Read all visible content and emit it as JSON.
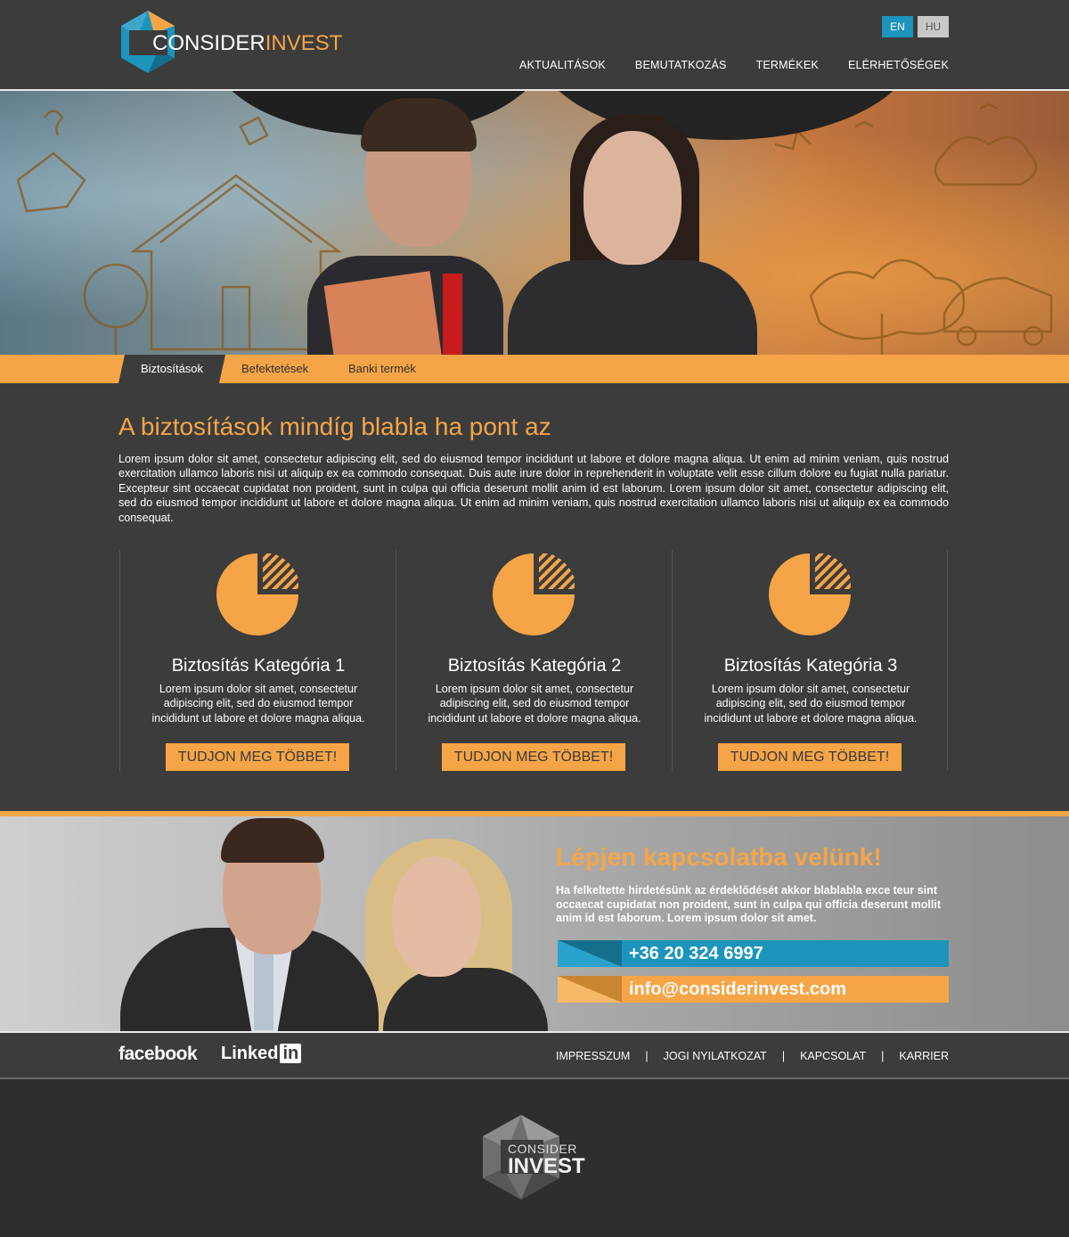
{
  "brand": {
    "name_part1": "CONSIDER",
    "name_part2": "INVEST"
  },
  "language": {
    "en": "EN",
    "hu": "HU"
  },
  "nav": {
    "items": [
      "AKTUALITÁSOK",
      "BEMUTATKOZÁS",
      "TERMÉKEK",
      "ELÉRHETŐSÉGEK"
    ]
  },
  "tabs": {
    "items": [
      "Biztosítások",
      "Befektetések",
      "Banki termék"
    ]
  },
  "main": {
    "title": "A biztosítások mindíg blabla ha pont az",
    "text": "Lorem ipsum dolor sit amet, consectetur adipiscing elit, sed do eiusmod tempor incididunt ut labore et dolore magna aliqua. Ut enim ad minim veniam, quis nostrud exercitation ullamco laboris nisi ut aliquip ex ea commodo consequat. Duis aute irure dolor in reprehenderit in voluptate velit esse cillum dolore eu fugiat nulla pariatur. Excepteur sint occaecat cupidatat non proident, sunt in culpa qui officia deserunt mollit anim id est laborum. Lorem ipsum dolor sit amet, consectetur adipiscing elit, sed do eiusmod tempor incididunt ut labore et dolore magna aliqua. Ut enim ad minim veniam, quis nostrud exercitation ullamco laboris nisi ut aliquip ex ea commodo consequat."
  },
  "cards": [
    {
      "title": "Biztosítás Kategória 1",
      "text": "Lorem ipsum dolor sit amet, consectetur adipiscing elit, sed do eiusmod tempor incididunt ut labore et dolore magna aliqua.",
      "button": "TUDJON MEG TÖBBET!",
      "icon": "pie-chart-icon"
    },
    {
      "title": "Biztosítás Kategória 2",
      "text": "Lorem ipsum dolor sit amet, consectetur adipiscing elit, sed do eiusmod tempor incididunt ut labore et dolore magna aliqua.",
      "button": "TUDJON MEG TÖBBET!",
      "icon": "pie-chart-icon"
    },
    {
      "title": "Biztosítás Kategória 3",
      "text": "Lorem ipsum dolor sit amet, consectetur adipiscing elit, sed do eiusmod tempor incididunt ut labore et dolore magna aliqua.",
      "button": "TUDJON MEG TÖBBET!",
      "icon": "pie-chart-icon"
    }
  ],
  "contact": {
    "title": "Lépjen kapcsolatba velünk!",
    "text": "Ha felkeltette hirdetésünk az érdeklődését akkor blablabla exce teur sint occaecat cupidatat non proident, sunt in culpa qui officia deserunt mollit anim id est laborum. Lorem ipsum dolor sit amet.",
    "phone": "+36 20 324 6997",
    "email": "info@considerinvest.com"
  },
  "footer": {
    "facebook": "facebook",
    "linkedin_1": "Linked",
    "linkedin_2": "in",
    "links": [
      "IMPRESSZUM",
      "JOGI NYILATKOZAT",
      "KAPCSOLAT",
      "KARRIER"
    ],
    "separator": "|"
  },
  "bottom_logo": {
    "line1": "CONSIDER",
    "line2": "INVEST"
  },
  "colors": {
    "accent": "#f5a547",
    "blue": "#1d94bb",
    "background": "#3c3c3c"
  }
}
